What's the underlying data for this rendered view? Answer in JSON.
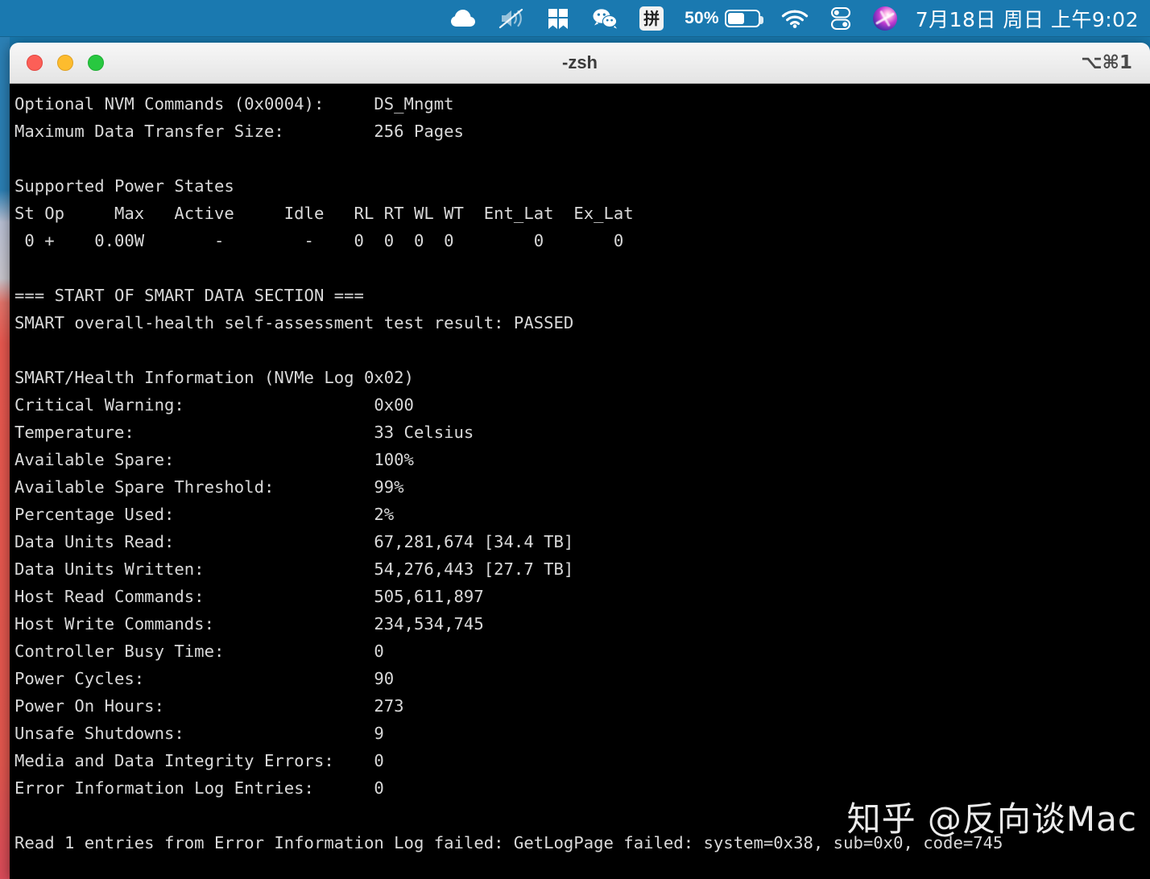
{
  "menubar": {
    "icons": [
      {
        "name": "cloud-sync-icon",
        "label": "Cloud"
      },
      {
        "name": "volume-muted-icon",
        "label": "Volume muted"
      },
      {
        "name": "split-window-icon",
        "label": "Split window"
      },
      {
        "name": "wechat-icon",
        "label": "WeChat"
      },
      {
        "name": "pinyin-input-icon",
        "label": "拼"
      },
      {
        "name": "battery-icon",
        "label": "Battery"
      },
      {
        "name": "wifi-icon",
        "label": "Wi-Fi"
      },
      {
        "name": "control-center-icon",
        "label": "Control Center"
      },
      {
        "name": "siri-icon",
        "label": "Siri"
      }
    ],
    "battery_percent": "50%",
    "battery_level": 50,
    "ime_label": "拼",
    "clock": "7月18日 周日 上午9:02",
    "bar_color": "#1a79b0"
  },
  "window": {
    "title": "-zsh",
    "tab_shortcut": "⌥⌘1",
    "traffic_lights": [
      {
        "name": "close-button",
        "color": "#fc5f57"
      },
      {
        "name": "minimize-button",
        "color": "#fdbc2e"
      },
      {
        "name": "maximize-button",
        "color": "#28c840"
      }
    ]
  },
  "terminal": {
    "foreground": "#d9d9d9",
    "background": "#000000",
    "lines": [
      "Optional NVM Commands (0x0004):     DS_Mngmt",
      "Maximum Data Transfer Size:         256 Pages",
      "",
      "Supported Power States",
      "St Op     Max   Active     Idle   RL RT WL WT  Ent_Lat  Ex_Lat",
      " 0 +    0.00W       -        -    0  0  0  0        0       0",
      "",
      "=== START OF SMART DATA SECTION ===",
      "SMART overall-health self-assessment test result: PASSED",
      "",
      "SMART/Health Information (NVMe Log 0x02)",
      "Critical Warning:                   0x00",
      "Temperature:                        33 Celsius",
      "Available Spare:                    100%",
      "Available Spare Threshold:          99%",
      "Percentage Used:                    2%",
      "Data Units Read:                    67,281,674 [34.4 TB]",
      "Data Units Written:                 54,276,443 [27.7 TB]",
      "Host Read Commands:                 505,611,897",
      "Host Write Commands:                234,534,745",
      "Controller Busy Time:               0",
      "Power Cycles:                       90",
      "Power On Hours:                     273",
      "Unsafe Shutdowns:                   9",
      "Media and Data Integrity Errors:    0",
      "Error Information Log Entries:      0",
      "",
      "Read 1 entries from Error Information Log failed: GetLogPage failed: system=0x38, sub=0x0, code=745"
    ],
    "smart_values": {
      "critical_warning": "0x00",
      "temperature": "33 Celsius",
      "available_spare": "100%",
      "available_spare_threshold": "99%",
      "percentage_used": "2%",
      "data_units_read": "67,281,674 [34.4 TB]",
      "data_units_written": "54,276,443 [27.7 TB]",
      "host_read_commands": "505,611,897",
      "host_write_commands": "234,534,745",
      "controller_busy_time": "0",
      "power_cycles": "90",
      "power_on_hours": "273",
      "unsafe_shutdowns": "9",
      "media_and_data_integrity_errors": "0",
      "error_information_log_entries": "0",
      "overall_health_result": "PASSED"
    }
  },
  "watermark": {
    "text": "知乎 @反向谈Mac"
  }
}
